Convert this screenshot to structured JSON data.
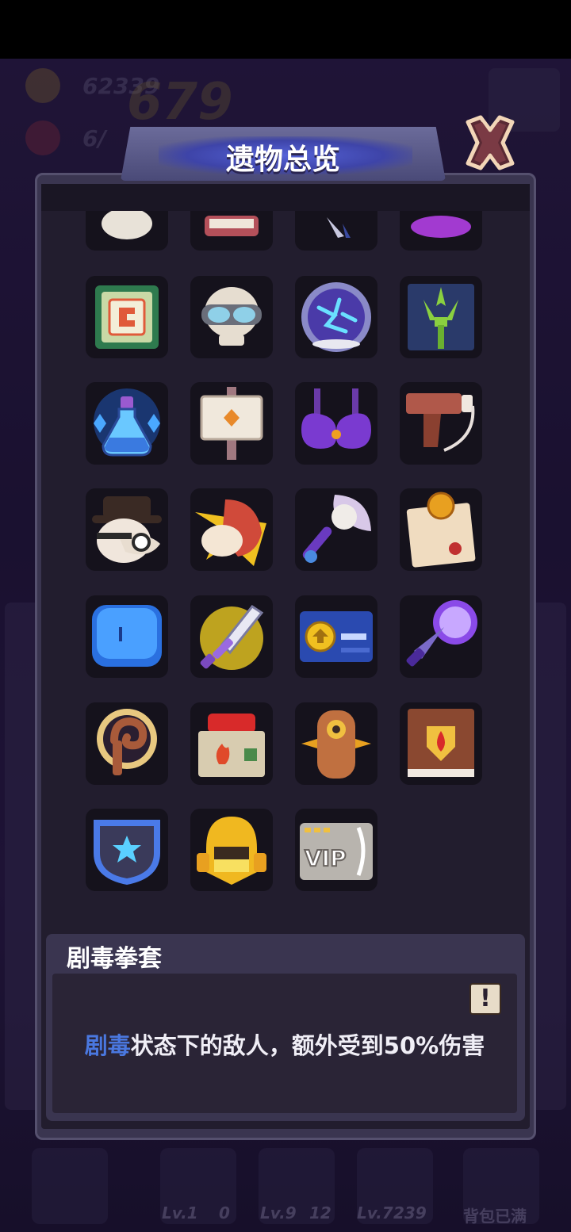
{
  "background": {
    "coins": "62339",
    "wave": "6/",
    "stage_banner": "679",
    "bottom": {
      "items": [
        {
          "level": "Lv.1",
          "count": "0"
        },
        {
          "level": "Lv.9",
          "count": "12"
        },
        {
          "level": "Lv.7",
          "count": "239"
        }
      ],
      "bag_full_label": "背包已满"
    }
  },
  "dialog": {
    "title": "遗物总览",
    "close_icon": "close-x-icon"
  },
  "relics": {
    "rows": [
      {
        "partial": true,
        "items": [
          "skull-relic-icon",
          "teeth-relic-icon",
          "feather-relic-icon",
          "purple-orb-relic-icon"
        ]
      },
      {
        "items": [
          "cpu-chip-icon",
          "goggles-skull-icon",
          "lightning-orb-icon",
          "trident-icon"
        ]
      },
      {
        "items": [
          "mana-potion-icon",
          "signpost-icon",
          "armor-top-icon",
          "blunderbuss-icon"
        ]
      },
      {
        "items": [
          "plague-doctor-icon",
          "flame-fist-icon",
          "skull-axe-icon",
          "contract-scroll-icon"
        ]
      },
      {
        "items": [
          "blue-slime-icon",
          "glowing-sword-icon",
          "id-card-icon",
          "purple-dagger-icon"
        ]
      },
      {
        "items": [
          "wooden-staff-icon",
          "red-button-box-icon",
          "wooden-totem-icon",
          "spell-book-icon"
        ]
      },
      {
        "items": [
          "star-shield-icon",
          "golden-helmet-icon",
          "vip-card-icon"
        ]
      }
    ]
  },
  "selected_relic": {
    "name": "剧毒拳套",
    "desc_highlight": "剧毒",
    "desc_rest": "状态下的敌人，额外受到50%伤害",
    "info_icon": "exclamation-info-icon"
  },
  "colors": {
    "panel": "#3a3550",
    "panel_inner": "#221d2e",
    "slot": "#15121c",
    "highlight_blue": "#4a78e0",
    "title_glow": "#5563d8"
  }
}
